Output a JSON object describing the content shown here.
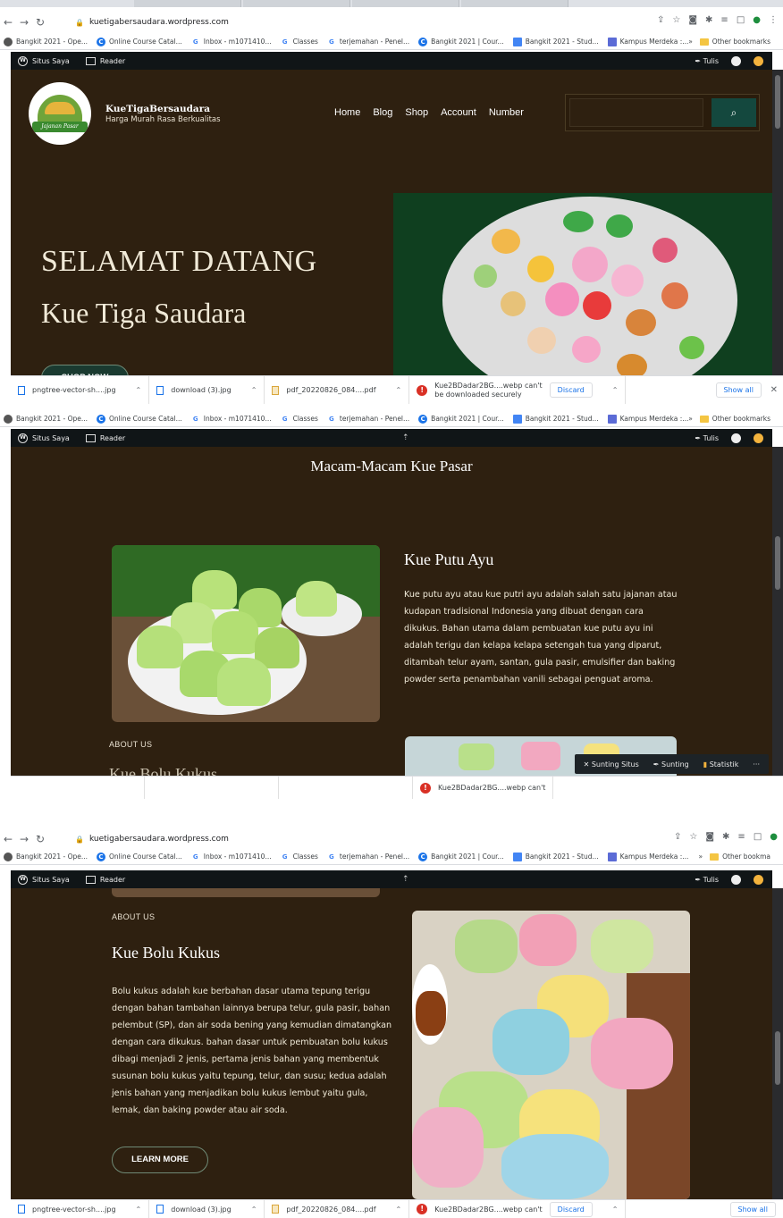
{
  "browser": {
    "url": "kuetigabersaudara.wordpress.com",
    "bookmarks": [
      "Bangkit 2021 - Ope...",
      "Online Course Catal...",
      "Inbox - m1071410...",
      "Classes",
      "terjemahan - Penel...",
      "Bangkit 2021 | Cour...",
      "Bangkit 2021 - Stud...",
      "Kampus Merdeka :..."
    ],
    "other_bookmarks": "Other bookmarks",
    "other_bookmarks_short": "Other bookma",
    "chevron": "»"
  },
  "wp_admin": {
    "my_site": "Situs Saya",
    "reader": "Reader",
    "write": "Tulis"
  },
  "site": {
    "logo_text": "Jajanan Pasar",
    "name": "KueTigaBersaudara",
    "tagline": "Harga Murah Rasa Berkualitas",
    "nav": [
      "Home",
      "Blog",
      "Shop",
      "Account",
      "Number"
    ],
    "hero_title": "SELAMAT DATANG",
    "hero_subtitle": "Kue Tiga Saudara",
    "shop_now": "SHOP NOW"
  },
  "downloads": {
    "items": [
      "pngtree-vector-sh....jpg",
      "download (3).jpg",
      "pdf_20220826_084....pdf"
    ],
    "blocked_line1": "Kue2BDadar2BG....webp can't",
    "blocked_line2": "be downloaded securely",
    "discard": "Discard",
    "show_all": "Show all"
  },
  "products": {
    "section_title": "Macam-Macam Kue Pasar",
    "putu_ayu": {
      "title": "Kue Putu Ayu",
      "text": "Kue putu ayu atau kue putri ayu adalah salah satu jajanan atau kudapan tradisional Indonesia yang dibuat dengan cara dikukus. Bahan utama dalam pembuatan kue putu ayu ini adalah terigu dan kelapa kelapa setengah tua yang diparut, ditambah telur ayam, santan, gula pasir, emulsifier dan baking powder serta penambahan vanili sebagai penguat aroma."
    },
    "about_label": "ABOUT US",
    "bolu": {
      "title": "Kue Bolu Kukus",
      "text": "Bolu kukus adalah kue berbahan dasar utama tepung terigu dengan bahan tambahan lainnya berupa telur, gula pasir, bahan pelembut (SP), dan air soda bening yang kemudian dimatangkan dengan cara dikukus. bahan dasar untuk pembuatan bolu kukus dibagi menjadi 2 jenis, pertama jenis bahan yang membentuk susunan bolu kukus yaitu tepung, telur, dan susu; kedua adalah jenis bahan yang menjadikan bolu kukus lembut yaitu gula, lemak, dan baking powder atau air soda.",
      "learn_more": "LEARN MORE"
    },
    "partial_title": "Kue Bolu Kukus"
  },
  "editor_bar": {
    "edit_site": "Sunting Situs",
    "edit": "Sunting",
    "stats": "Statistik",
    "more": "···"
  },
  "colors": {
    "site_bg": "#2e2010",
    "accent": "#14483e"
  }
}
